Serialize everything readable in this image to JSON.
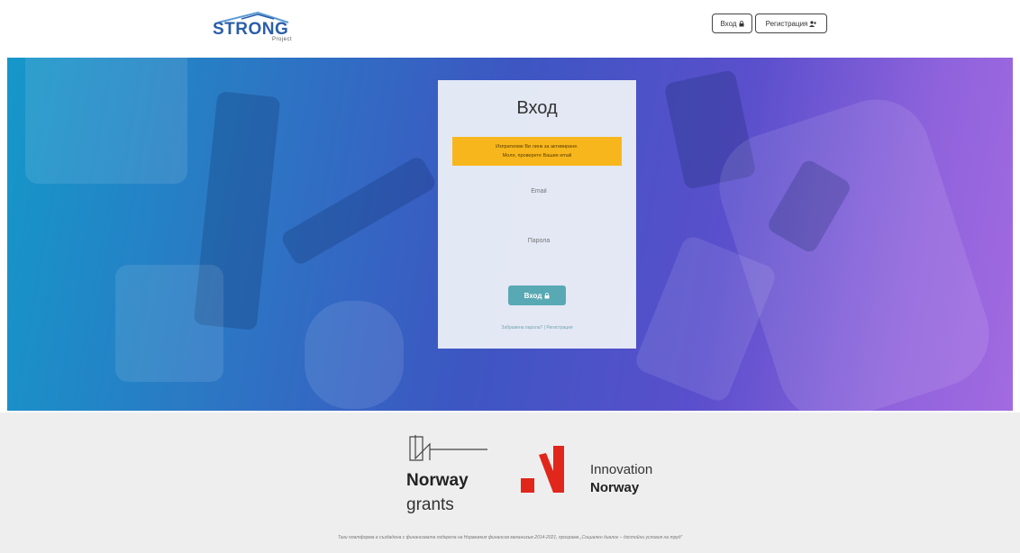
{
  "header": {
    "logo_text": "STRONG",
    "logo_sub": "Project",
    "login_label": "Вход",
    "register_label": "Регистрация"
  },
  "card": {
    "title": "Вход",
    "alert_line1": "Изпратихме Ви линк за активиране.",
    "alert_line2": "Моля, проверете Вашия email",
    "email_label": "Email",
    "password_label": "Парола",
    "submit_label": "Вход",
    "link_forgot": "Забравена парола?",
    "link_register": "Регистрация"
  },
  "footer": {
    "grants_word1": "Norway",
    "grants_word2": "grants",
    "innovation_word1": "Innovation",
    "innovation_word2": "Norway",
    "disclaimer": "Тази платформа е създадена с финансовата подкрепа на Норвежкия финансов механизъм 2014-2021, програма „Социален диалог – достойни условия на труд“"
  },
  "colors": {
    "brand_blue": "#2a5ea8",
    "alert_bg": "#f7b71c",
    "button_teal": "#58a9b3",
    "innovation_red": "#e1261c"
  }
}
